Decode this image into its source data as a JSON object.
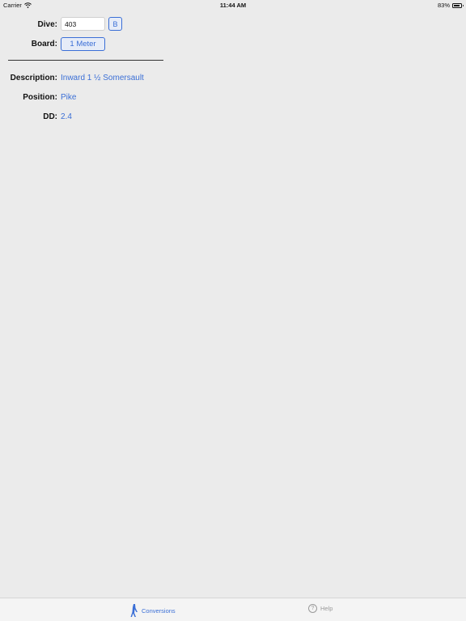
{
  "status_bar": {
    "carrier": "Carrier",
    "time": "11:44 AM",
    "battery": "83%",
    "battery_level": 0.83
  },
  "form": {
    "dive_label": "Dive:",
    "dive_value": "403",
    "b_button": "B",
    "board_label": "Board:",
    "board_value": "1 Meter"
  },
  "details": {
    "description_label": "Description:",
    "description_value": "Inward 1 ½ Somersault",
    "position_label": "Position:",
    "position_value": "Pike",
    "dd_label": "DD:",
    "dd_value": "2.4"
  },
  "tab_bar": {
    "conversions": "Conversions",
    "help": "Help",
    "active_tab": "conversions",
    "icons": {
      "conversions": "diver-icon",
      "help": "question-circle-icon"
    }
  },
  "colors": {
    "accent": "#3b6fd6",
    "background": "#ebebeb",
    "inactive": "#9a9a9a"
  }
}
